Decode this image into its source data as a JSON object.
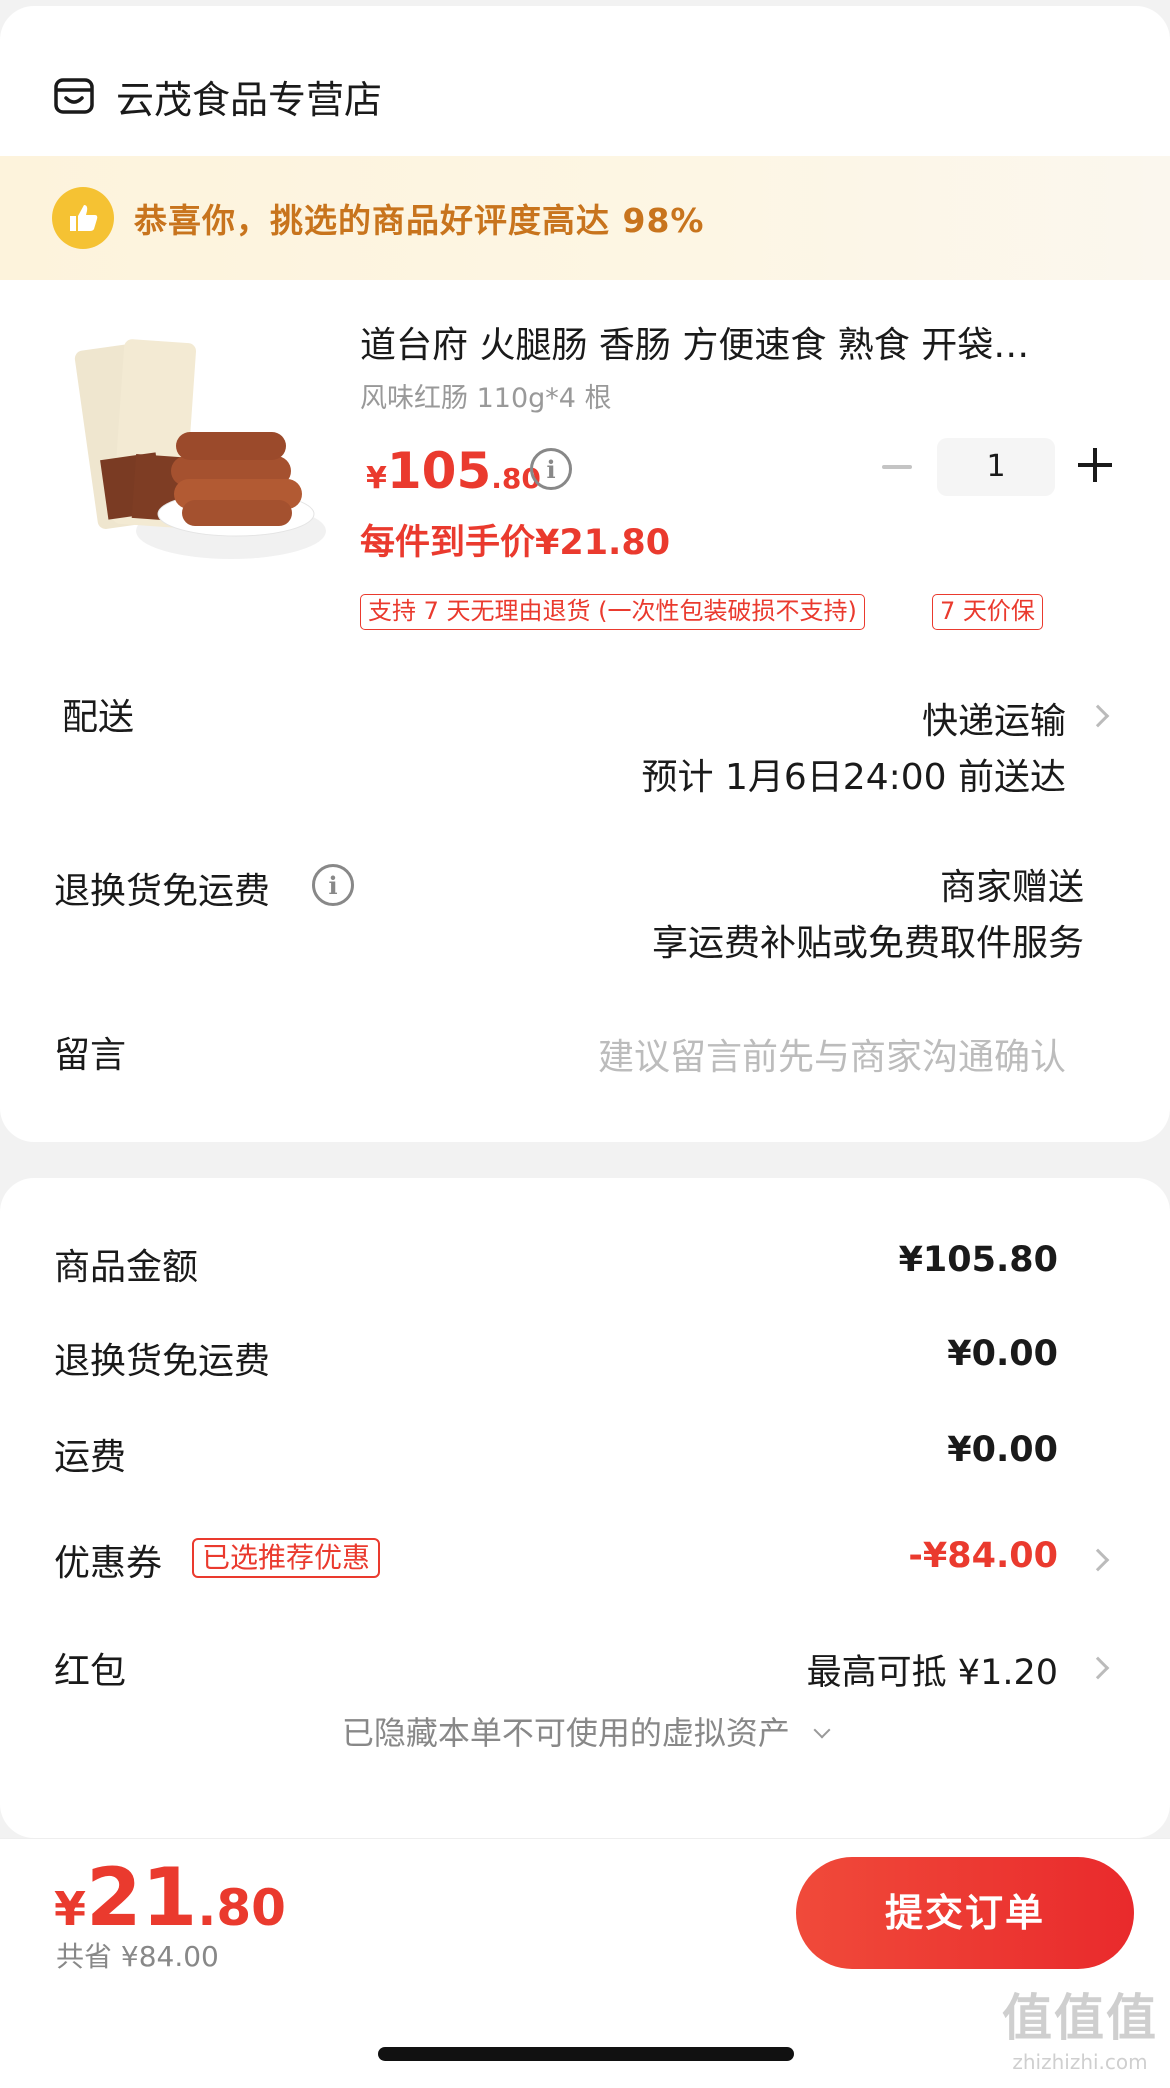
{
  "store": {
    "name": "云茂食品专营店",
    "icon": "store-icon"
  },
  "banner": {
    "text": "恭喜你，挑选的商品好评度高达 98%",
    "icon": "thumbs-up-icon"
  },
  "product": {
    "title": "道台府 火腿肠 香肠 方便速食 熟食 开袋…",
    "spec": "风味红肠 110g*4 根",
    "price_currency": "¥",
    "price_int": "105",
    "price_dec": ".80",
    "unit_price": "每件到手价¥21.80",
    "quantity": "1",
    "tags": [
      "支持 7 天无理由退货 (一次性包装破损不支持)",
      "7 天价保"
    ]
  },
  "delivery": {
    "label": "配送",
    "method": "快递运输",
    "eta": "预计 1月6日24:00 前送达"
  },
  "return_shipping": {
    "label": "退换货免运费",
    "value": "商家赠送",
    "desc": "享运费补贴或免费取件服务"
  },
  "message": {
    "label": "留言",
    "placeholder": "建议留言前先与商家沟通确认"
  },
  "summary": {
    "goods_label": "商品金额",
    "goods_value": "¥105.80",
    "return_label": "退换货免运费",
    "return_value": "¥0.00",
    "freight_label": "运费",
    "freight_value": "¥0.00",
    "coupon_label": "优惠券",
    "coupon_tag": "已选推荐优惠",
    "coupon_value": "-¥84.00",
    "redpacket_label": "红包",
    "redpacket_value": "最高可抵 ¥1.20",
    "hidden_note": "已隐藏本单不可使用的虚拟资产"
  },
  "footer": {
    "total_currency": "¥",
    "total_int": "21",
    "total_dec": ".80",
    "saved": "共省 ¥84.00",
    "submit_label": "提交订单"
  },
  "watermark": {
    "line1": "值值值",
    "line2": "zhizhizhi.com"
  },
  "colors": {
    "accent": "#ea3a2e",
    "banner_text": "#c8741d",
    "banner_bg": "#fdf3dc"
  }
}
